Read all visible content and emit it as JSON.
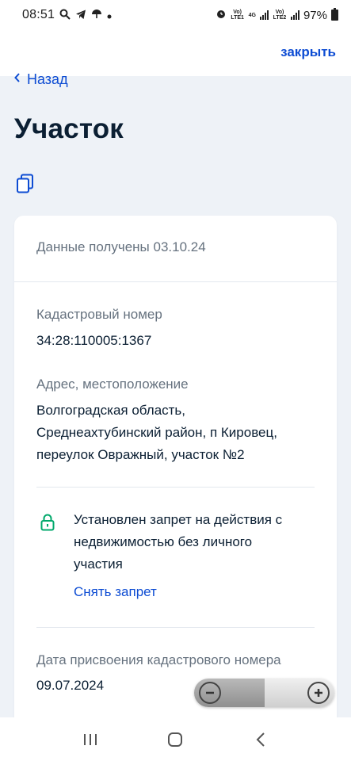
{
  "status_bar": {
    "time": "08:51",
    "battery": "97%",
    "net_sim1": "Vo) LTE1",
    "net_4g": "4G",
    "net_sim2": "Vo) LTE2"
  },
  "top_bar": {
    "close_label": "закрыть"
  },
  "back": {
    "label": "Назад"
  },
  "page": {
    "title": "Участок"
  },
  "card": {
    "received": "Данные получены 03.10.24",
    "cadastral_label": "Кадастровый номер",
    "cadastral_value": "34:28:110005:1367",
    "address_label": "Адрес, местоположение",
    "address_line1": "Волгоградская область,",
    "address_line2": "Среднеахтубинский район, п Кировец,",
    "address_line3": "переулок Овражный, участок №2",
    "restriction_line1": "Установлен запрет на действия с",
    "restriction_line2": "недвижимостью без личного",
    "restriction_line3": "участия",
    "unlock_label": "Снять запрет",
    "assign_date_label": "Дата присвоения кадастрового номера",
    "assign_date_value": "09.07.2024"
  },
  "colors": {
    "accent": "#0d4cd3",
    "lock": "#00a86b",
    "text": "#0b1f33",
    "muted": "#66727f",
    "background": "#eef2f7"
  }
}
